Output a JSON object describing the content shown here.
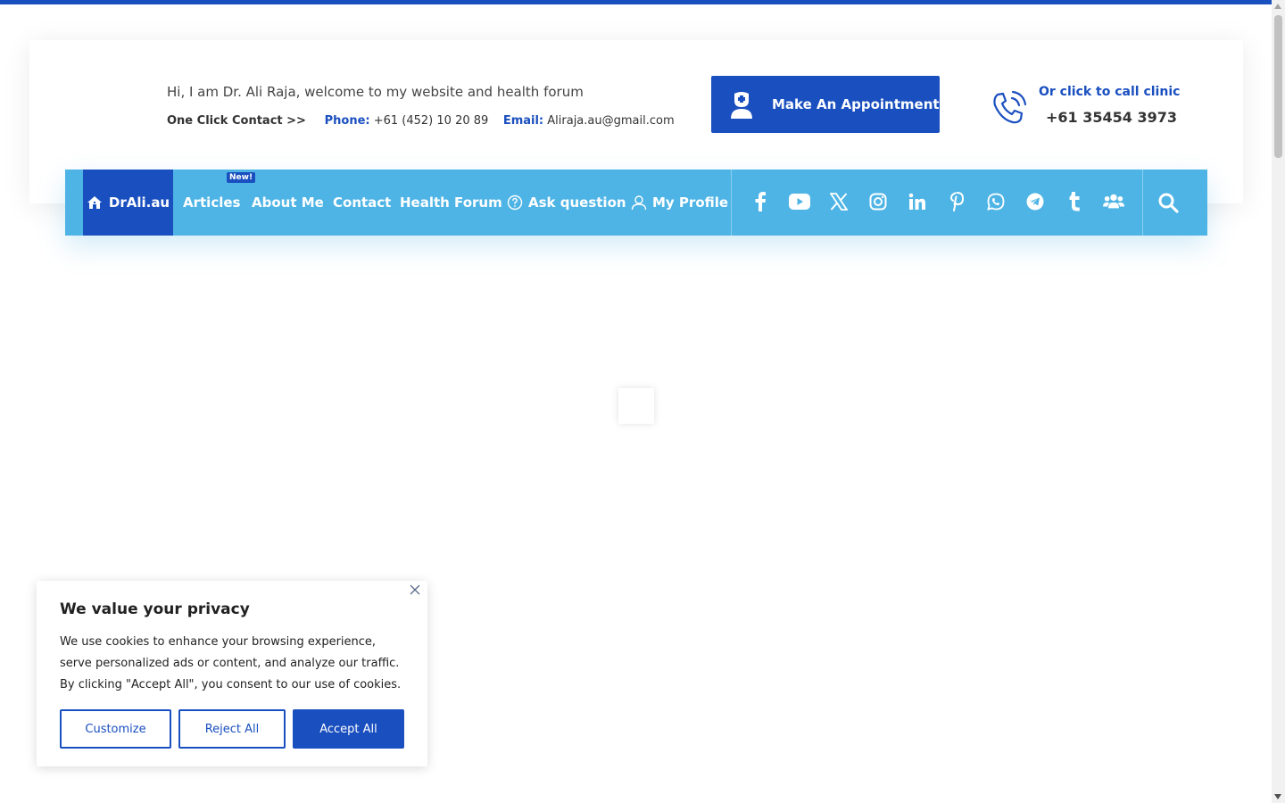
{
  "header": {
    "welcome": "Hi, I am Dr. Ali Raja, welcome to my website and health forum",
    "one_click": "One Click Contact >>",
    "phone_label": "Phone:",
    "phone": "+61 (452) 10 20 89",
    "email_label": "Email:",
    "email": "Aliraja.au@gmail.com",
    "appointment_label": "Make An Appointment",
    "call_label": "Or click to call clinic",
    "call_number": "+61 35454 3973"
  },
  "nav": {
    "home_label": "DrAli.au",
    "items": [
      {
        "label": "Articles",
        "badge": "New!"
      },
      {
        "label": "About Me"
      },
      {
        "label": "Contact"
      },
      {
        "label": "Health Forum"
      },
      {
        "label": "Ask question"
      },
      {
        "label": "My Profile"
      }
    ],
    "social_icons": [
      "facebook-icon",
      "youtube-icon",
      "x-icon",
      "instagram-icon",
      "linkedin-icon",
      "pinterest-icon",
      "whatsapp-icon",
      "telegram-icon",
      "tumblr-icon",
      "group-icon"
    ]
  },
  "cookie": {
    "title": "We value your privacy",
    "text": "We use cookies to enhance your browsing experience, serve personalized ads or content, and analyze our traffic. By clicking \"Accept All\", you consent to our use of cookies.",
    "customize": "Customize",
    "reject": "Reject All",
    "accept": "Accept All"
  },
  "colors": {
    "primary": "#1a4fbf",
    "nav_bg": "#4eb4e5"
  }
}
